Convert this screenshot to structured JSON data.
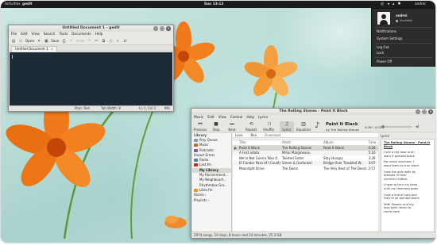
{
  "topbar": {
    "activities": "Activities",
    "app_name": "gedit",
    "clock": "Sun 13:12",
    "user": "andrei"
  },
  "user_menu": {
    "name": "andrei",
    "status": "Available",
    "items": [
      "Notifications",
      "System Settings",
      "Log Out",
      "Lock",
      "Power Off"
    ]
  },
  "gedit": {
    "title": "Untitled Document 1 - gedit",
    "menu": [
      "File",
      "Edit",
      "View",
      "Search",
      "Tools",
      "Documents",
      "Help"
    ],
    "toolbar": {
      "open_label": "Open",
      "save_label": "Save",
      "undo_label": "Undo"
    },
    "tab_label": "Untitled Document 1",
    "status": {
      "language": "Plain Text",
      "tab_width": "Tab Width: 8",
      "position": "Ln 1, Col 1",
      "mode": "INS"
    }
  },
  "rhythmbox": {
    "title": "The Rolling Stones - Paint It Black",
    "menu": [
      "Music",
      "Edit",
      "View",
      "Control",
      "Help",
      "Lyrics"
    ],
    "toolbar": [
      "Previous",
      "Stop",
      "Next",
      "Repeat",
      "Shuffle",
      "Lyrics",
      "Equalizer"
    ],
    "now_playing": {
      "title": "Paint It Black",
      "subtitle": "by The Rolling Stones",
      "time": "0:36 / 4:28",
      "progress_fraction": 0.13
    },
    "sidebar": {
      "library_header": "Library",
      "library_items": [
        "Play Queue",
        "Music",
        "Podcasts",
        "Import Errors",
        "Radio",
        "Last.fm"
      ],
      "selected_item": "My Library",
      "sub_items": [
        "My Recommend...",
        "My Neighbourh...",
        "Rhythmbox Gro...",
        "Libre.fm"
      ],
      "groups": [
        "Stores",
        "Playlists"
      ]
    },
    "browser_tabs": [
      "Love",
      "Ban",
      "Download"
    ],
    "columns": [
      "Title",
      "Artist",
      "Album",
      "Time"
    ],
    "rows": [
      [
        "Paint It Black",
        "The Rolling Stones",
        "Paint It Black",
        "4:28"
      ],
      [
        "A Fost odata",
        "Mihai Margineanu",
        "",
        "5:16"
      ],
      [
        "We're Not Gonna Take It",
        "Twisted Sister",
        "Stay Hungry",
        "3:39"
      ],
      [
        "El Condor Pasa (If I Could)",
        "Simon & Garfunkel",
        "Bridge Over Troubled W...",
        "3:07"
      ],
      [
        "Moonlight Drive",
        "The Doors",
        "The Very Best of The Doors",
        "2:57"
      ]
    ],
    "lyrics": {
      "header": "Lyrics",
      "title": "The Rolling Stones - Paint It Black",
      "stanzas": [
        [
          "I see a red door and I",
          "want it painted black"
        ],
        [
          "No colors anymore, I",
          "want them to turn black"
        ],
        [
          "I see the girls walk by",
          "dressed in their",
          "summer clothes"
        ],
        [
          "I have to turn my head",
          "until my darkness goes"
        ],
        [
          "I see a line of cars and",
          "they're all painted black"
        ],
        [
          "With flowers and my",
          "love both never to",
          "come back"
        ]
      ]
    },
    "status": "2974 songs, 10 days, 8 hours and 24 minutes, 25.3 GB"
  }
}
